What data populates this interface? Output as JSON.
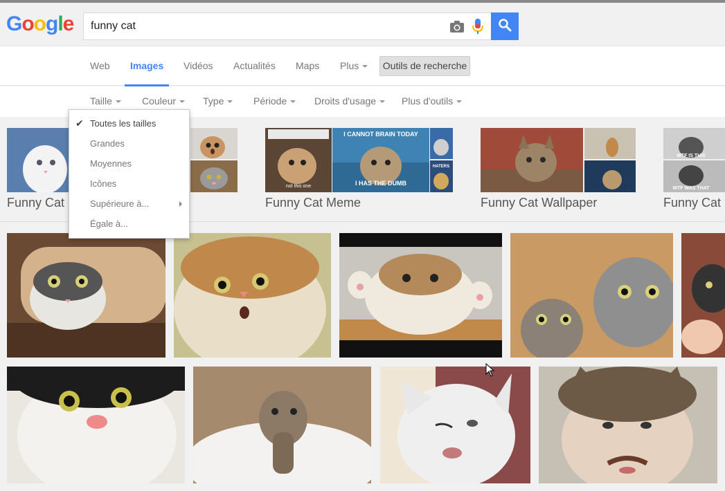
{
  "header": {
    "logo_text": "Google",
    "search_value": "funny cat",
    "camera_icon": "camera-icon",
    "mic_icon": "microphone-icon",
    "search_icon": "search-icon",
    "accent_color": "#4285f4"
  },
  "tabs": [
    {
      "label": "Web"
    },
    {
      "label": "Images"
    },
    {
      "label": "Vidéos"
    },
    {
      "label": "Actualités"
    },
    {
      "label": "Maps"
    },
    {
      "label": "Plus"
    }
  ],
  "active_tab": "Images",
  "tools_button": "Outils de recherche",
  "filters": [
    {
      "label": "Taille"
    },
    {
      "label": "Couleur"
    },
    {
      "label": "Type"
    },
    {
      "label": "Période"
    },
    {
      "label": "Droits d'usage"
    },
    {
      "label": "Plus d'outils"
    }
  ],
  "size_menu": {
    "items": [
      {
        "label": "Toutes les tailles",
        "checked": true
      },
      {
        "label": "Grandes"
      },
      {
        "label": "Moyennes"
      },
      {
        "label": "Icônes"
      },
      {
        "label": "Supérieure à..."
      },
      {
        "label": "Égale à..."
      }
    ]
  },
  "related": [
    {
      "label": "Funny Cat"
    },
    {
      "label": "Funny Cat Meme"
    },
    {
      "label": "Funny Cat Wallpaper"
    },
    {
      "label": "Funny Cat"
    }
  ],
  "meme_text": {
    "top": "I CANNOT BRAIN TODAY",
    "bottom": "I HAS THE DUMB",
    "side1": "HATERS",
    "caption1": "not this one",
    "wtf1": "WTF IS THIS",
    "wtf2": "WTF WAS THAT"
  }
}
